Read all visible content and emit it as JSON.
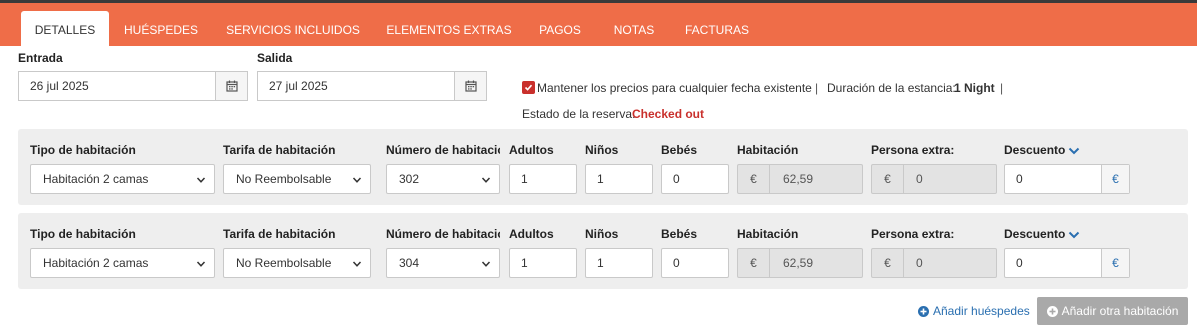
{
  "tabs": [
    {
      "label": "DETALLES",
      "active": true
    },
    {
      "label": "HUÉSPEDES"
    },
    {
      "label": "SERVICIOS INCLUIDOS"
    },
    {
      "label": "ELEMENTOS EXTRAS"
    },
    {
      "label": "PAGOS"
    },
    {
      "label": "NOTAS"
    },
    {
      "label": "FACTURAS"
    }
  ],
  "dates": {
    "entrada_label": "Entrada",
    "entrada_value": "26 jul 2025",
    "salida_label": "Salida",
    "salida_value": "27 jul 2025"
  },
  "options": {
    "keep_prices_label": "Mantener los precios para cualquier fecha existente",
    "keep_prices_checked": true,
    "separator": "|",
    "duration_label": "Duración de la estancia:",
    "duration_value": "1 Night",
    "status_label": "Estado de la reserva:",
    "status_value": "Checked out"
  },
  "columns": {
    "room_type": "Tipo de habitación",
    "rate": "Tarifa de habitación",
    "room_number": "Número de habitación",
    "adults": "Adultos",
    "children": "Niños",
    "babies": "Bebés",
    "room_price": "Habitación",
    "extra_person": "Persona extra:",
    "discount": "Descuento"
  },
  "currency": "€",
  "rooms": [
    {
      "room_type": "Habitación 2 camas",
      "rate": "No Reembolsable",
      "room_number": "302",
      "adults": "1",
      "children": "1",
      "babies": "0",
      "room_price": "62,59",
      "extra_person": "0",
      "discount": "0"
    },
    {
      "room_type": "Habitación 2 camas",
      "rate": "No Reembolsable",
      "room_number": "304",
      "adults": "1",
      "children": "1",
      "babies": "0",
      "room_price": "62,59",
      "extra_person": "0",
      "discount": "0"
    }
  ],
  "actions": {
    "add_guests": "Añadir huéspedes",
    "add_room": "Añadir otra habitación"
  },
  "colors": {
    "brand": "#ef6d48",
    "status": "#c9302c",
    "link": "#2a6fb0"
  }
}
